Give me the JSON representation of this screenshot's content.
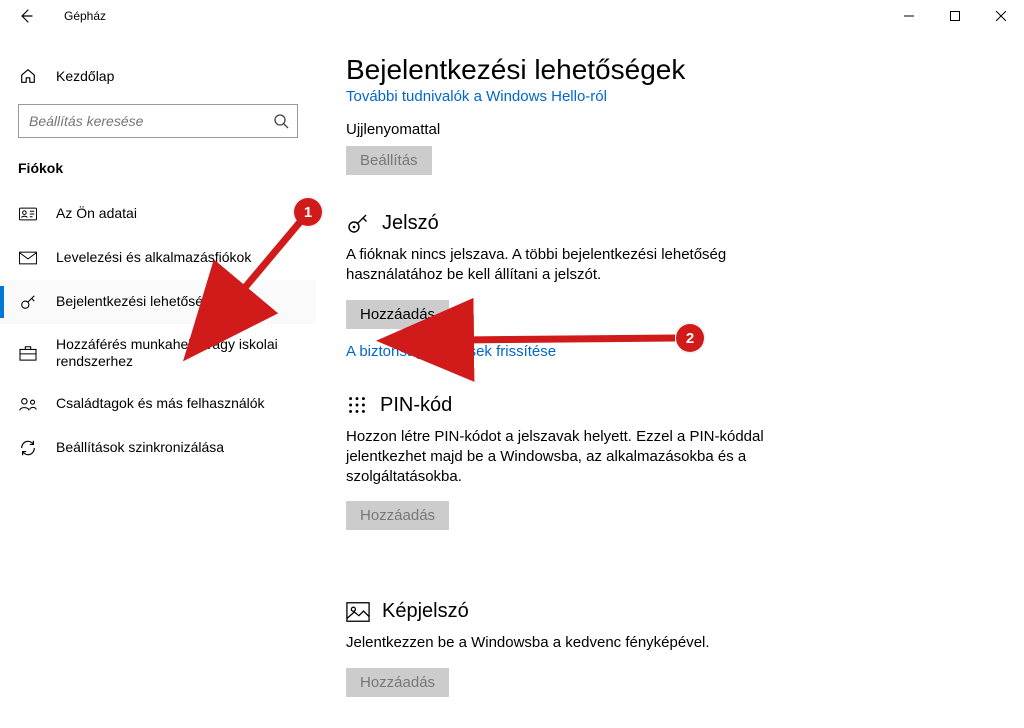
{
  "titlebar": {
    "app_title": "Gépház"
  },
  "sidebar": {
    "home_label": "Kezdőlap",
    "search_placeholder": "Beállítás keresése",
    "section_label": "Fiókok",
    "items": [
      {
        "label": "Az Ön adatai"
      },
      {
        "label": "Levelezési és alkalmazásfiókok"
      },
      {
        "label": "Bejelentkezési lehetőségek"
      },
      {
        "label": "Hozzáférés munkahelyi vagy iskolai rendszerhez"
      },
      {
        "label": "Családtagok és más felhasználók"
      },
      {
        "label": "Beállítások szinkronizálása"
      }
    ]
  },
  "main": {
    "page_title": "Bejelentkezési lehetőségek",
    "hello_more_link": "További tudnivalók a Windows Hello-ról",
    "fingerprint_label": "Ujjlenyomattal",
    "fingerprint_button": "Beállítás",
    "password": {
      "title": "Jelszó",
      "desc": "A fióknak nincs jelszava. A többi bejelentkezési lehetőség használatához be kell állítani a jelszót.",
      "button": "Hozzáadás",
      "security_link": "A biztonsági kérdések frissítése"
    },
    "pin": {
      "title": "PIN-kód",
      "desc": "Hozzon létre PIN-kódot a jelszavak helyett. Ezzel a PIN-kóddal jelentkezhet majd be a Windowsba, az alkalmazásokba és a szolgáltatásokba.",
      "button": "Hozzáadás"
    },
    "picture": {
      "title": "Képjelszó",
      "desc": "Jelentkezzen be a Windowsba a kedvenc fényképével.",
      "button": "Hozzáadás"
    }
  },
  "annotations": {
    "marker1": "1",
    "marker2": "2"
  }
}
